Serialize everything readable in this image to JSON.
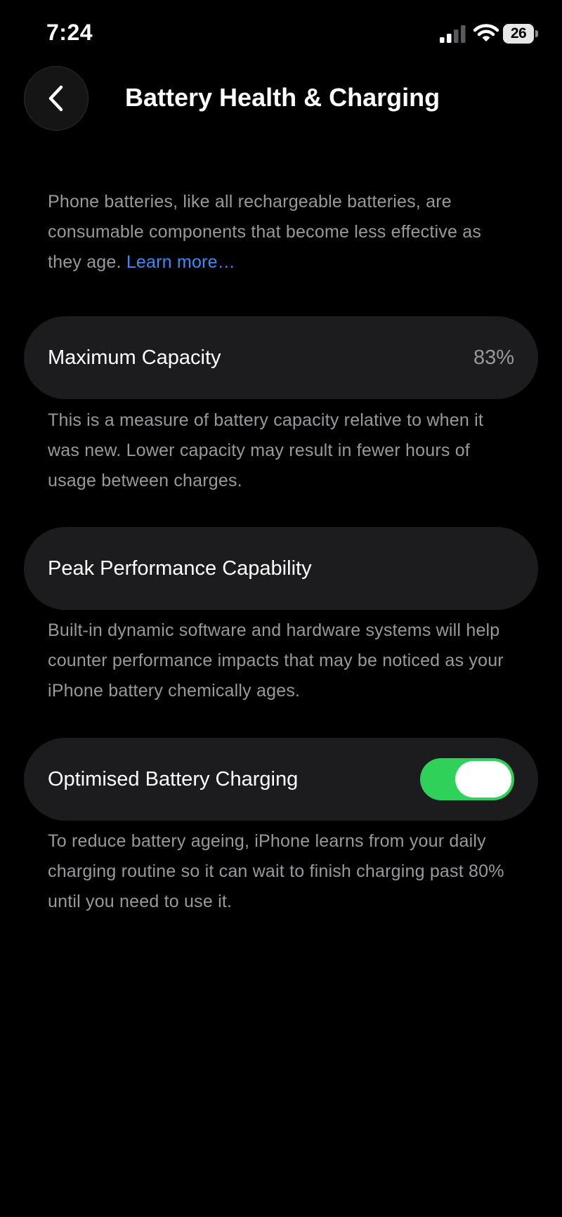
{
  "status_bar": {
    "time": "7:24",
    "battery_level": "26",
    "icons": [
      "signal-icon",
      "wifi-icon",
      "battery-icon"
    ]
  },
  "header": {
    "back_icon": "chevron-left-icon",
    "title": "Battery Health & Charging"
  },
  "intro": {
    "text": "Phone batteries, like all rechargeable batteries, are consumable components that become less effective as they age.",
    "link": "Learn more…"
  },
  "rows": [
    {
      "label": "Maximum Capacity",
      "value": "83%",
      "footer": "This is a measure of battery capacity relative to when it was new. Lower capacity may result in fewer hours of usage between charges."
    },
    {
      "label": "Peak Performance Capability",
      "footer": "Built-in dynamic software and hardware systems will help counter performance impacts that may be noticed as your iPhone battery chemically ages."
    },
    {
      "label": "Optimised Battery Charging",
      "toggle_on": true,
      "footer": "To reduce battery ageing, iPhone learns from your daily charging routine so it can wait to finish charging past 80% until you need to use it."
    }
  ],
  "colors": {
    "background": "#000000",
    "row_background": "#1c1c1e",
    "secondary_text": "#98989d",
    "link": "#3b8cf5",
    "toggle_on": "#30d158"
  }
}
